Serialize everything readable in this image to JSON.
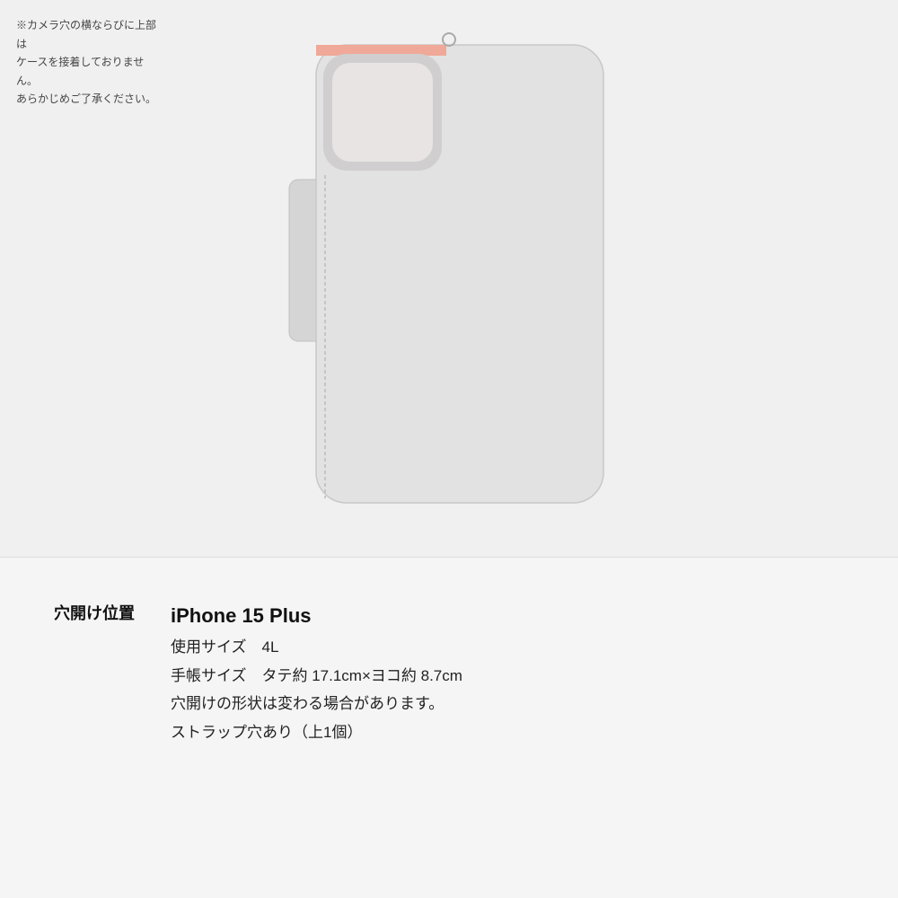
{
  "page": {
    "background_color": "#f0f0f0"
  },
  "illustration": {
    "alt": "Phone case back view illustration"
  },
  "note": {
    "text": "※カメラ穴の横ならびに上部は\nケースを接着しておりません。\nあらかじめご了承ください。"
  },
  "info_section": {
    "label": "穴開け位置",
    "model_name": "iPhone 15 Plus",
    "lines": [
      "使用サイズ　4L",
      "手帳サイズ　タテ約 17.1cm×ヨコ約 8.7cm",
      "穴開けの形状は変わる場合があります。",
      "ストラップ穴あり（上1個）"
    ]
  }
}
